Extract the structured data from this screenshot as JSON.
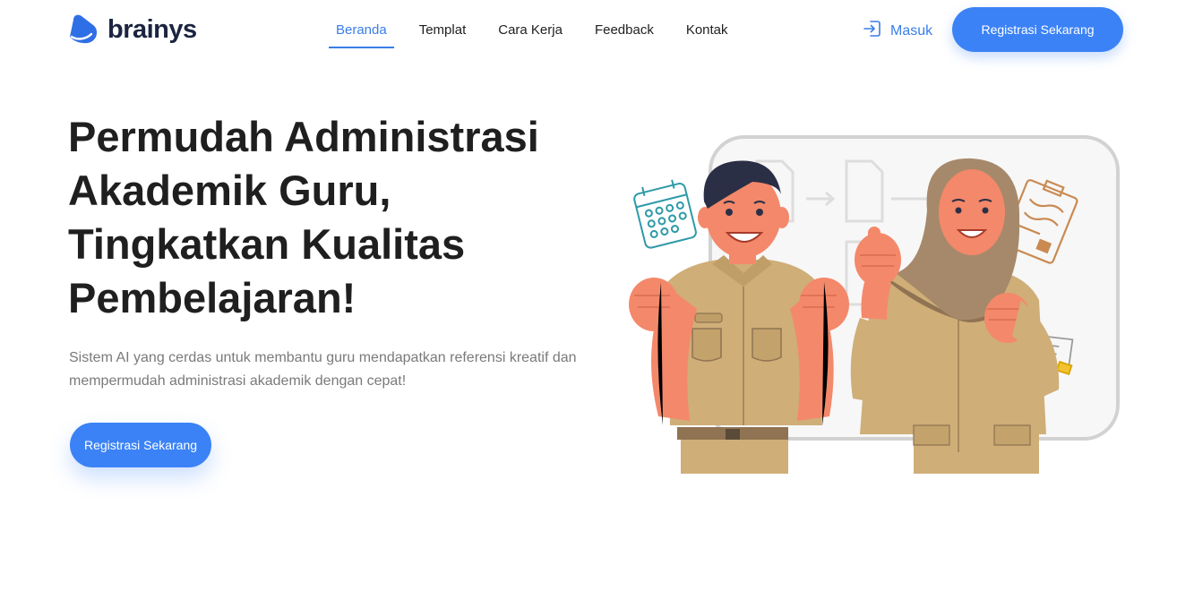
{
  "brand": {
    "name": "brainys",
    "logo_icon": "brainys-logo-icon",
    "accent": "#3b82f6"
  },
  "nav": {
    "items": [
      {
        "label": "Beranda",
        "active": true
      },
      {
        "label": "Templat",
        "active": false
      },
      {
        "label": "Cara Kerja",
        "active": false
      },
      {
        "label": "Feedback",
        "active": false
      },
      {
        "label": "Kontak",
        "active": false
      }
    ],
    "login_label": "Masuk",
    "login_icon": "sign-in-icon",
    "register_label": "Registrasi Sekarang"
  },
  "hero": {
    "title_lines": [
      "Permudah Administrasi",
      "Akademik Guru,",
      "Tingkatkan Kualitas",
      "Pembelajaran!"
    ],
    "subtitle": "Sistem AI yang cerdas untuk membantu guru mendapatkan referensi kreatif dan mempermudah administrasi akademik dengan cepat!",
    "cta_label": "Registrasi Sekarang",
    "illustration": "teachers-celebrating-illustration"
  },
  "colors": {
    "primary": "#3b82f6",
    "text": "#1f1f1f",
    "muted": "#7a7a7a",
    "uniform": "#cfae78"
  }
}
